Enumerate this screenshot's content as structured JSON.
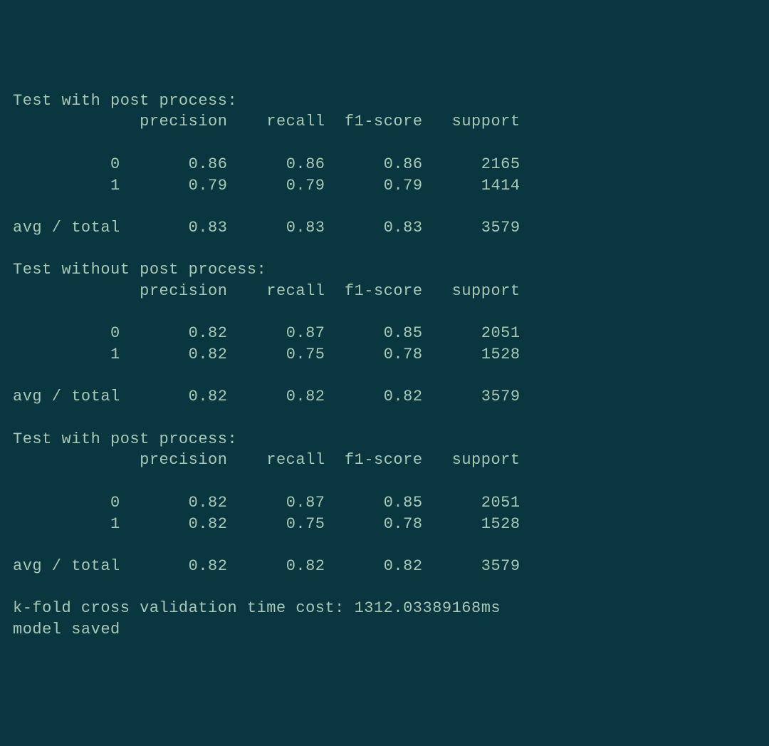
{
  "reports": [
    {
      "title": "Test with post process:",
      "headers": {
        "precision": "precision",
        "recall": "recall",
        "f1score": "f1-score",
        "support": "support"
      },
      "rows": [
        {
          "label": "0",
          "precision": "0.86",
          "recall": "0.86",
          "f1score": "0.86",
          "support": "2165"
        },
        {
          "label": "1",
          "precision": "0.79",
          "recall": "0.79",
          "f1score": "0.79",
          "support": "1414"
        }
      ],
      "summary": {
        "label": "avg / total",
        "precision": "0.83",
        "recall": "0.83",
        "f1score": "0.83",
        "support": "3579"
      }
    },
    {
      "title": "Test without post process:",
      "headers": {
        "precision": "precision",
        "recall": "recall",
        "f1score": "f1-score",
        "support": "support"
      },
      "rows": [
        {
          "label": "0",
          "precision": "0.82",
          "recall": "0.87",
          "f1score": "0.85",
          "support": "2051"
        },
        {
          "label": "1",
          "precision": "0.82",
          "recall": "0.75",
          "f1score": "0.78",
          "support": "1528"
        }
      ],
      "summary": {
        "label": "avg / total",
        "precision": "0.82",
        "recall": "0.82",
        "f1score": "0.82",
        "support": "3579"
      }
    },
    {
      "title": "Test with post process:",
      "headers": {
        "precision": "precision",
        "recall": "recall",
        "f1score": "f1-score",
        "support": "support"
      },
      "rows": [
        {
          "label": "0",
          "precision": "0.82",
          "recall": "0.87",
          "f1score": "0.85",
          "support": "2051"
        },
        {
          "label": "1",
          "precision": "0.82",
          "recall": "0.75",
          "f1score": "0.78",
          "support": "1528"
        }
      ],
      "summary": {
        "label": "avg / total",
        "precision": "0.82",
        "recall": "0.82",
        "f1score": "0.82",
        "support": "3579"
      }
    }
  ],
  "footer": {
    "timing": "k-fold cross validation time cost: 1312.03389168ms",
    "saved": "model saved"
  }
}
